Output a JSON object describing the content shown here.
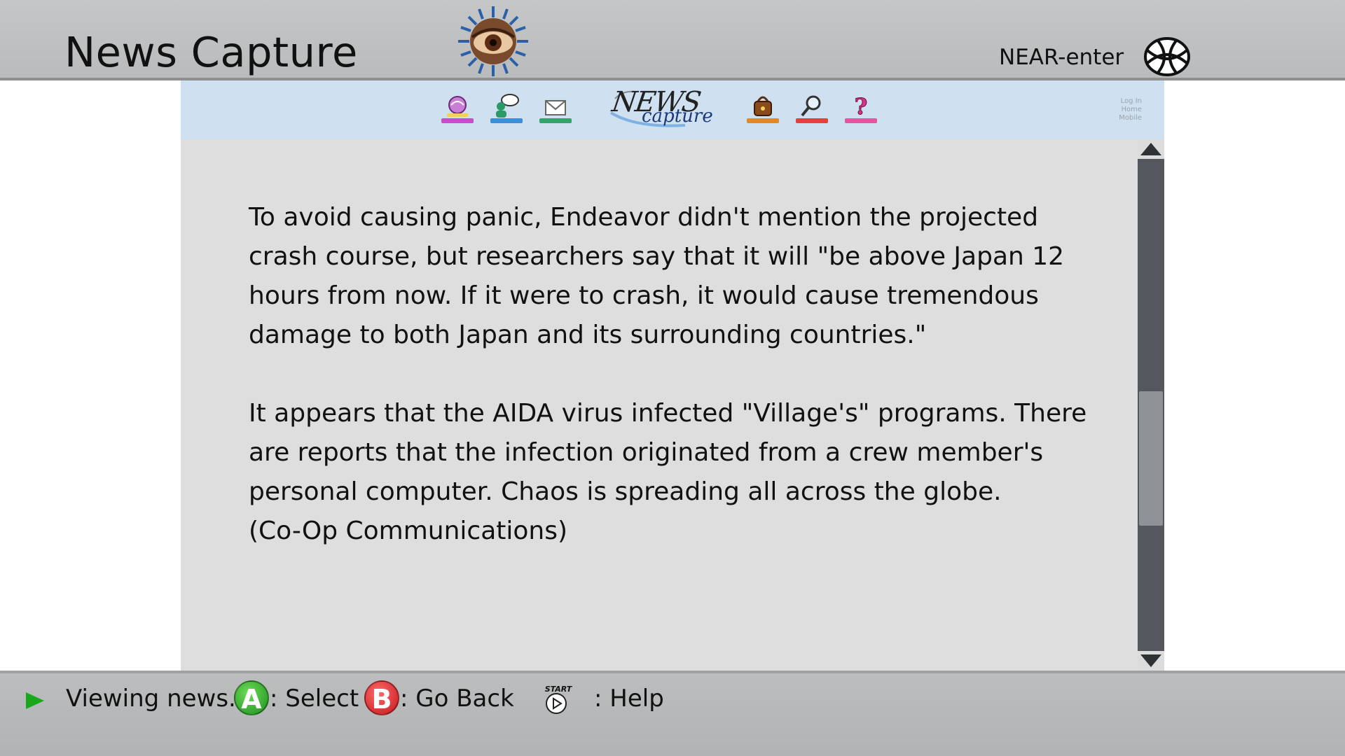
{
  "header": {
    "title": "News Capture",
    "network_status": "NEAR-enter",
    "emblem_icon": "eye-emblem-icon",
    "globe_icon": "globe-icon"
  },
  "site": {
    "logo_word_1": "NEWS",
    "logo_word_2": "capture",
    "nav_icons": [
      {
        "name": "world-news-icon",
        "color": "#c64ecb"
      },
      {
        "name": "forum-icon",
        "color": "#3b8ed8"
      },
      {
        "name": "mail-icon",
        "color": "#35a36c"
      },
      {
        "name": "shop-bag-icon",
        "color": "#e0892a"
      },
      {
        "name": "search-icon",
        "color": "#e0433e"
      },
      {
        "name": "help-icon",
        "color": "#e2579f"
      }
    ],
    "mini_links": [
      "Log In",
      "Home",
      "Mobile"
    ]
  },
  "article": {
    "paragraph_1": "To avoid causing panic, Endeavor didn't mention the projected crash course, but researchers say that it will \"be above Japan 12 hours from now. If it were to crash, it would cause tremendous damage to both Japan and its surrounding countries.\"",
    "paragraph_2": "It appears that the AIDA virus infected \"Village's\" programs. There are reports that the infection originated from a crew member's personal computer. Chaos is spreading all across the globe.",
    "credit": "(Co-Op Communications)"
  },
  "scroll": {
    "position_fraction": 0.65
  },
  "help_bar": {
    "status": "Viewing news.",
    "a_button": "A",
    "a_label": ": Select",
    "b_button": "B",
    "b_label": ": Go Back",
    "start_button": "START",
    "start_label": ": Help"
  },
  "colors": {
    "nav_background": "#cfe0f1",
    "page_background": "#dedede",
    "a_button": "#2fa82a",
    "b_button": "#d4191f",
    "play_icon": "#19a81c"
  }
}
